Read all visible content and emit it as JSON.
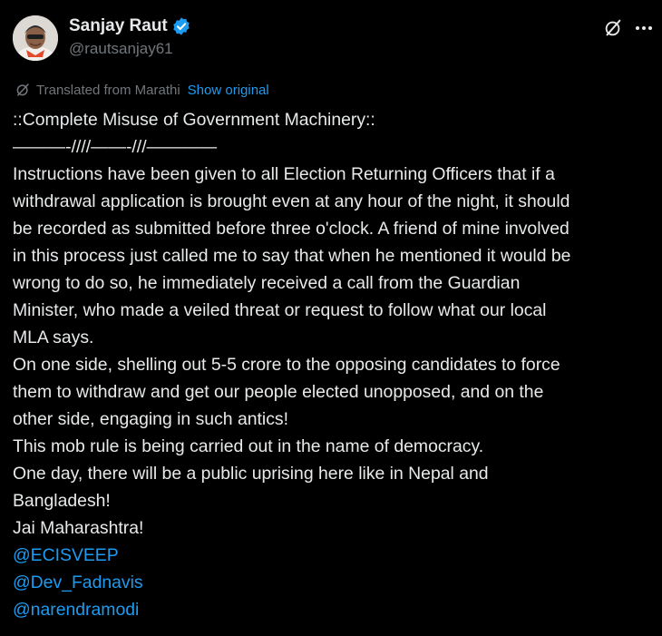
{
  "author": {
    "display_name": "Sanjay Raut",
    "handle": "@rautsanjay61",
    "verified": true
  },
  "header": {
    "grok_icon": "grok-icon",
    "more_icon": "more-icon"
  },
  "translation": {
    "icon": "translate-icon",
    "label": "Translated from Marathi",
    "show_original": "Show original"
  },
  "tweet": {
    "lines": [
      "::Complete Misuse of Government Machinery::",
      "———-////——-///————",
      "Instructions have been given to all Election Returning Officers that if a",
      "withdrawal application is brought even at any hour of the night, it should",
      "be recorded as submitted before three o'clock. A friend of mine involved",
      "in this process just called me to say that when he mentioned it would be",
      "wrong to do so, he immediately received a call from the Guardian",
      "Minister, who made a veiled threat or request to follow what our local",
      "MLA says.",
      "On one side, shelling out 5-5 crore to the opposing candidates to force",
      "them to withdraw and get our people elected unopposed, and on the",
      "other side, engaging in such antics!",
      "This mob rule is being carried out in the name of democracy.",
      "One day, there will be a public uprising here like in Nepal and",
      "Bangladesh!",
      "Jai Maharashtra!"
    ],
    "mentions": [
      "@ECISVEEP",
      "@Dev_Fadnavis",
      "@narendramodi"
    ]
  },
  "colors": {
    "background": "#000000",
    "text": "#e7e9ea",
    "secondary": "#71767b",
    "accent": "#1d9bf0"
  }
}
